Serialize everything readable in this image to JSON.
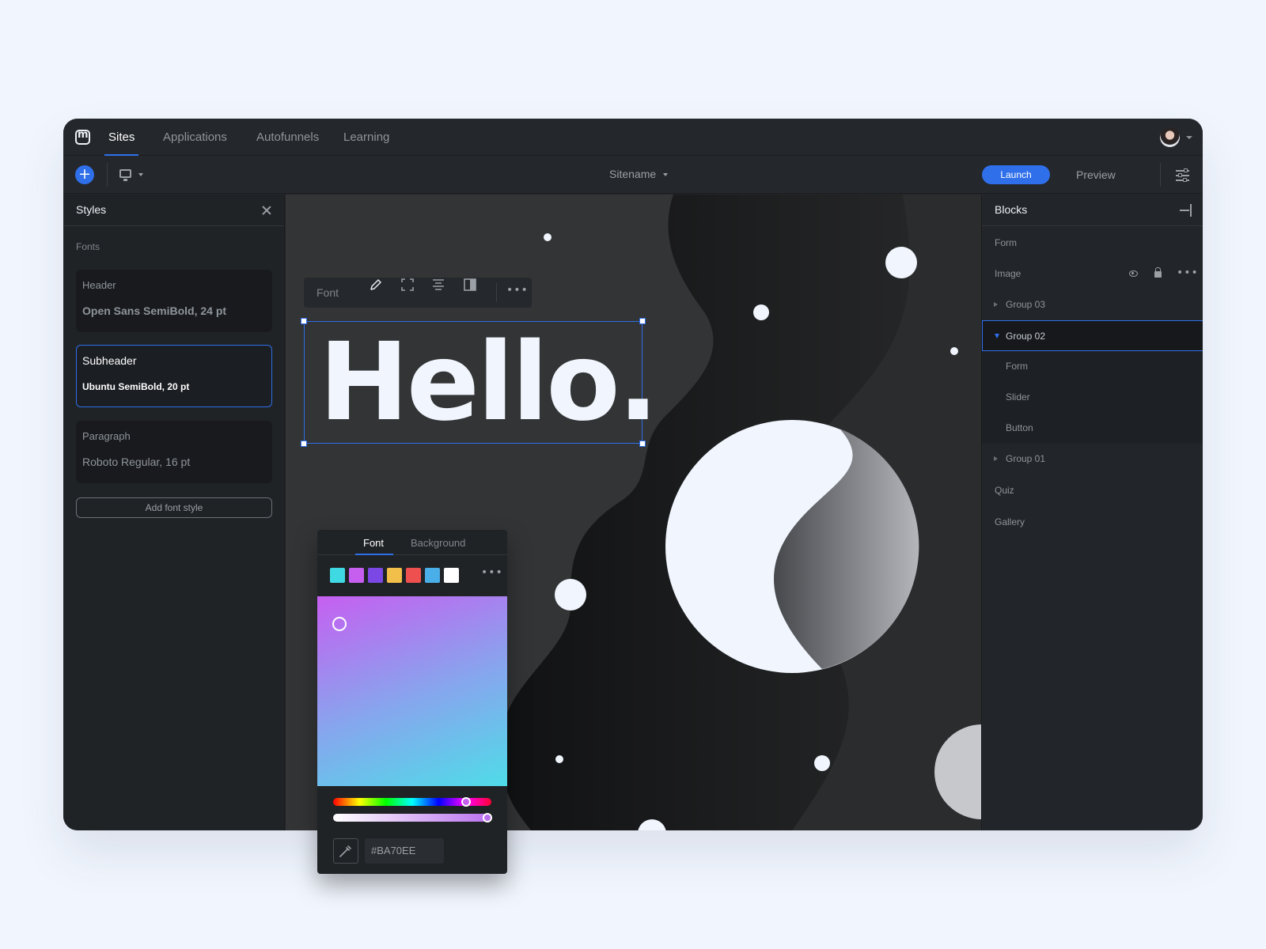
{
  "nav": {
    "tabs": [
      "Sites",
      "Applications",
      "Autofunnels",
      "Learning"
    ],
    "active_tab": "Sites"
  },
  "toolbar": {
    "add_icon": "+",
    "device": "desktop-icon",
    "sitename": "Sitename",
    "launch_label": "Launch",
    "preview_label": "Preview"
  },
  "styles_panel": {
    "title": "Styles",
    "section_label": "Fonts",
    "font_styles": [
      {
        "name": "Header",
        "value": "Open Sans SemiBold, 24 pt"
      },
      {
        "name": "Subheader",
        "value": "Ubuntu SemiBold, 20 pt",
        "selected": true
      },
      {
        "name": "Paragraph",
        "value": "Roboto Regular, 16 pt"
      }
    ],
    "add_button": "Add font style"
  },
  "canvas": {
    "format_toolbar_label": "Font",
    "hello_text": "Hello."
  },
  "blocks_panel": {
    "title": "Blocks",
    "items": [
      {
        "label": "Form"
      },
      {
        "label": "Image"
      },
      {
        "label": "Group 03"
      },
      {
        "label": "Group 02"
      },
      {
        "label": "Form"
      },
      {
        "label": "Slider"
      },
      {
        "label": "Button"
      },
      {
        "label": "Group 01"
      },
      {
        "label": "Quiz"
      },
      {
        "label": "Gallery"
      }
    ]
  },
  "color_picker": {
    "tabs": [
      "Font",
      "Background"
    ],
    "active_tab": "Font",
    "swatches": [
      "#3fd9e3",
      "#c65ff0",
      "#7b48e6",
      "#f2c04a",
      "#ee5050",
      "#4aaee8",
      "#ffffff"
    ],
    "hex_value": "#BA70EE"
  },
  "colors": {
    "accent": "#2f6fea",
    "app_bg": "#222529",
    "page_bg": "#f1f6fe"
  }
}
